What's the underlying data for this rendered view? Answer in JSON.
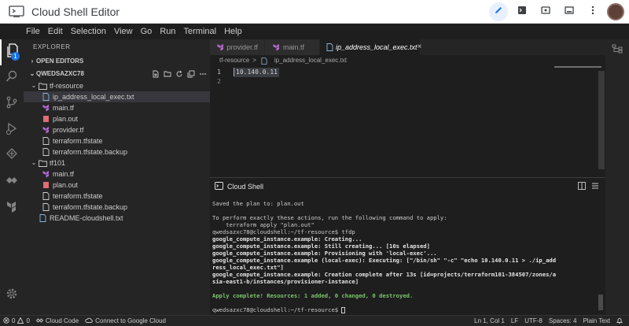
{
  "app": {
    "title": "Cloud Shell Editor"
  },
  "topbar": {
    "icons": [
      "pencil-icon",
      "terminal-icon",
      "preview-icon",
      "layout-icon",
      "more-vertical-icon"
    ],
    "accent": "#1a73e8"
  },
  "menu": [
    "File",
    "Edit",
    "Selection",
    "View",
    "Go",
    "Run",
    "Terminal",
    "Help"
  ],
  "activity": {
    "badge": "1",
    "icons": [
      "files-icon",
      "search-icon",
      "source-control-icon",
      "run-debug-icon",
      "extensions-icon",
      "cloud-code-icon",
      "terraform-icon",
      "settings-icon"
    ]
  },
  "explorer": {
    "title": "EXPLORER",
    "open_editors": "OPEN EDITORS",
    "workspace": "QWEDSAZXC78",
    "tree": [
      {
        "label": "tf-resource",
        "type": "folder"
      },
      {
        "label": "ip_address_local_exec.txt",
        "type": "txt"
      },
      {
        "label": "main.tf",
        "type": "tf"
      },
      {
        "label": "plan.out",
        "type": "out"
      },
      {
        "label": "provider.tf",
        "type": "tf"
      },
      {
        "label": "terraform.tfstate",
        "type": "txt"
      },
      {
        "label": "terraform.tfstate.backup",
        "type": "txt"
      },
      {
        "label": "tf101",
        "type": "folder"
      },
      {
        "label": "main.tf",
        "type": "tf"
      },
      {
        "label": "plan.out",
        "type": "out"
      },
      {
        "label": "terraform.tfstate",
        "type": "txt"
      },
      {
        "label": "terraform.tfstate.backup",
        "type": "txt"
      },
      {
        "label": "README-cloudshell.txt",
        "type": "txt"
      }
    ]
  },
  "tabs": [
    {
      "label": "provider.tf"
    },
    {
      "label": "main.tf"
    },
    {
      "label": "ip_address_local_exec.txt"
    }
  ],
  "breadcrumb": {
    "folder": "tf-resource",
    "file": "ip_address_local_exec.txt",
    "sep": ">"
  },
  "editor": {
    "lines": [
      {
        "num": "1",
        "text": "10.140.0.11"
      },
      {
        "num": "2",
        "text": ""
      }
    ]
  },
  "terminal": {
    "title": "Cloud Shell",
    "lines": [
      {
        "t": "Saved the plan to: plan.out",
        "s": ""
      },
      {
        "t": "",
        "s": ""
      },
      {
        "t": "To perform exactly these actions, run the following command to apply:",
        "s": ""
      },
      {
        "t": "    terraform apply \"plan.out\"",
        "s": ""
      },
      {
        "t": "qwedsazxc78@cloudshell:~/tf-resource$ tfdp",
        "s": "prompt"
      },
      {
        "t": "google_compute_instance.example: Creating...",
        "s": "b"
      },
      {
        "t": "google_compute_instance.example: Still creating... [10s elapsed]",
        "s": "b"
      },
      {
        "t": "google_compute_instance.example: Provisioning with 'local-exec'...",
        "s": "b"
      },
      {
        "t": "google_compute_instance.example (local-exec): Executing: [\"/bin/sh\" \"-c\" \"echo 10.140.0.11 > ./ip_add",
        "s": "b"
      },
      {
        "t": "ress_local_exec.txt\"]",
        "s": "b"
      },
      {
        "t": "google_compute_instance.example: Creation complete after 13s [id=projects/terraform101-384507/zones/a",
        "s": "b"
      },
      {
        "t": "sia-east1-b/instances/provisioner-instance]",
        "s": "b"
      },
      {
        "t": "",
        "s": ""
      },
      {
        "t": "Apply complete! Resources: 1 added, 0 changed, 0 destroyed.",
        "s": "g"
      },
      {
        "t": "",
        "s": ""
      },
      {
        "t": "qwedsazxc78@cloudshell:~/tf-resource$ ",
        "s": "prompt"
      }
    ]
  },
  "status": {
    "errors": "0",
    "warnings": "0",
    "cloud_code": "Cloud Code",
    "connect": "Connect to Google Cloud",
    "position": "Ln 1, Col 1",
    "eol": "LF",
    "encoding": "UTF-8",
    "spaces": "Spaces: 4",
    "language": "Plain Text"
  }
}
